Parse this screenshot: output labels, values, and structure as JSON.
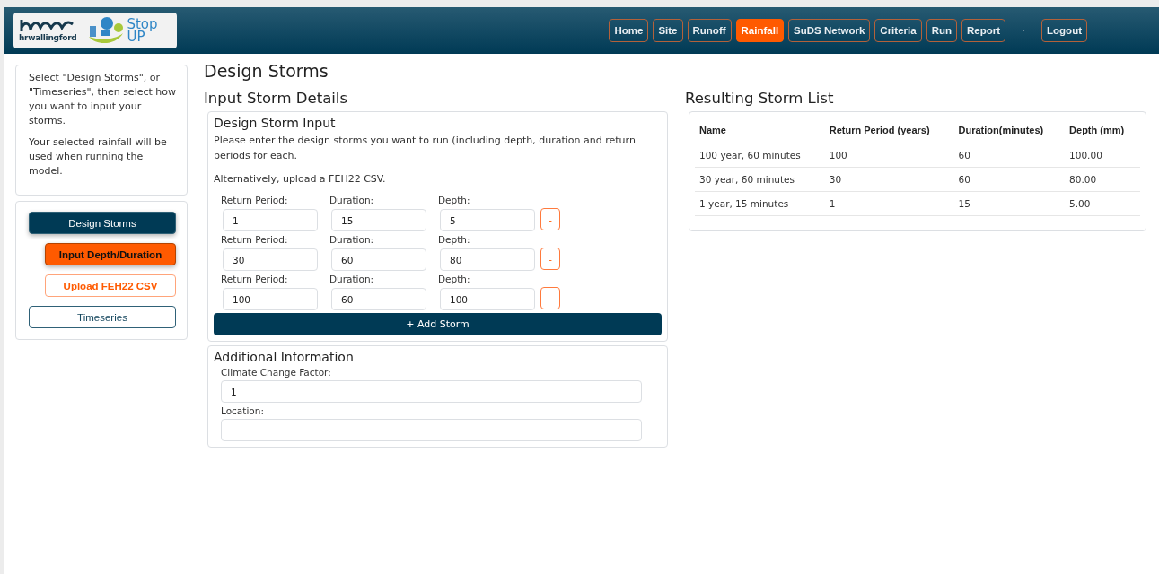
{
  "header": {
    "logos": {
      "brand": "hrwallingford",
      "product_line1": "Stop",
      "product_line2": "UP"
    },
    "nav": [
      {
        "label": "Home",
        "selected": false
      },
      {
        "label": "Site",
        "selected": false
      },
      {
        "label": "Runoff",
        "selected": false
      },
      {
        "label": "Rainfall",
        "selected": true
      },
      {
        "label": "SuDS Network",
        "selected": false
      },
      {
        "label": "Criteria",
        "selected": false
      },
      {
        "label": "Run",
        "selected": false
      },
      {
        "label": "Report",
        "selected": false
      }
    ],
    "logout": "Logout"
  },
  "sidebar": {
    "help": [
      "Select \"Design Storms\", or \"Timeseries\", then select how you want to input your storms.",
      "Your selected rainfall will be used when running the model."
    ],
    "options": [
      {
        "label": "Design Storms",
        "kind": "main",
        "selected": true
      },
      {
        "label": "Input Depth/Duration",
        "kind": "sub",
        "selected": true
      },
      {
        "label": "Upload FEH22 CSV",
        "kind": "sub",
        "selected": false
      },
      {
        "label": "Timeseries",
        "kind": "main",
        "selected": false
      }
    ]
  },
  "page_title": "Design Storms",
  "input_section": {
    "title": "Input Storm Details",
    "design_storm_input": {
      "title": "Design Storm Input",
      "intro": "Please enter the design storms you want to run (including depth, duration and return periods for each.",
      "alt": "Alternatively, upload a FEH22 CSV.",
      "storms": [
        {
          "return_period_label": "Return Period:",
          "return_period": "1",
          "duration_label": "Duration:",
          "duration": "15",
          "depth_label": "Depth:",
          "depth": "5",
          "remove": "-"
        },
        {
          "return_period_label": "Return Period:",
          "return_period": "30",
          "duration_label": "Duration:",
          "duration": "60",
          "depth_label": "Depth:",
          "depth": "80",
          "remove": "-"
        },
        {
          "return_period_label": "Return Period:",
          "return_period": "100",
          "duration_label": "Duration:",
          "duration": "60",
          "depth_label": "Depth:",
          "depth": "100",
          "remove": "-"
        }
      ],
      "add_button": "+ Add Storm"
    },
    "additional_information": {
      "title": "Additional Information",
      "climate_change_label": "Climate Change Factor:",
      "climate_change_factor": "1",
      "location_label": "Location:"
    }
  },
  "result_section": {
    "title": "Resulting Storm List",
    "table": {
      "columns": [
        "Name",
        "Return Period (years)",
        "Duration(minutes)",
        "Depth (mm)"
      ],
      "rows": [
        [
          "100 year, 60 minutes",
          "100",
          "60",
          "100.00"
        ],
        [
          "30 year, 60 minutes",
          "30",
          "60",
          "80.00"
        ],
        [
          "1 year, 15 minutes",
          "1",
          "15",
          "5.00"
        ]
      ]
    }
  }
}
